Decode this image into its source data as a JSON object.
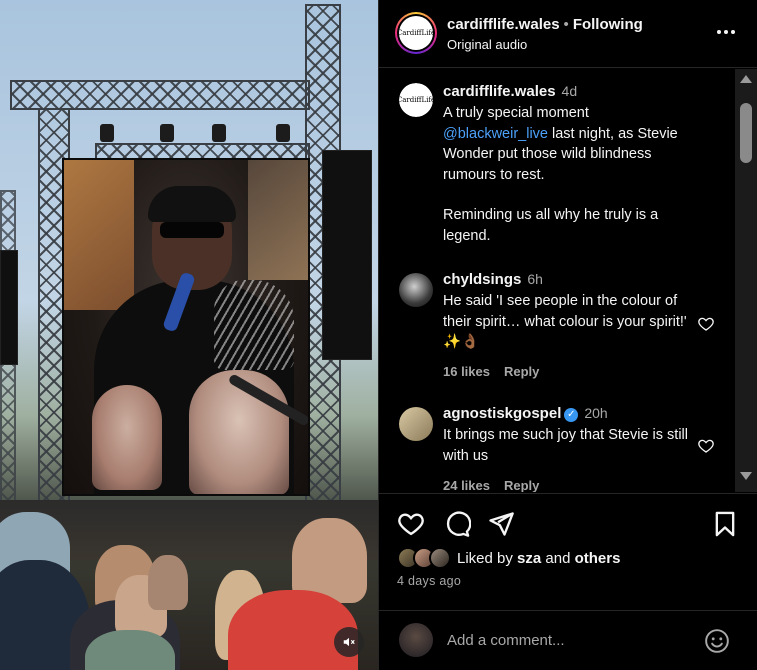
{
  "media": {
    "mute_icon": "speaker-muted-icon"
  },
  "header": {
    "username": "cardifflife.wales",
    "separator": "•",
    "follow_state": "Following",
    "audio": "Original audio",
    "avatar_text": "CardiffLife",
    "more_icon": "more-options-icon"
  },
  "caption": {
    "username": "cardifflife.wales",
    "time": "4d",
    "line1": "A truly special moment",
    "mention": "@blackweir_live",
    "line2": " last night, as Stevie Wonder put those wild blindness rumours to rest.",
    "line3": "Reminding us all why he truly is a legend."
  },
  "comments": [
    {
      "username": "chyldsings",
      "time": "6h",
      "text": "He said 'I see people in the colour of their spirit… what colour is your spirit!' ✨👌🏾",
      "likes": "16 likes",
      "reply": "Reply"
    },
    {
      "username": "agnostiskgospel",
      "verified": true,
      "time": "20h",
      "text": "It brings me such joy that Stevie is still with us",
      "likes": "24 likes",
      "reply": "Reply"
    }
  ],
  "actions": {
    "like_icon": "heart-icon",
    "comment_icon": "comment-icon",
    "share_icon": "share-icon",
    "save_icon": "bookmark-icon",
    "liked_by_prefix": "Liked by",
    "liked_by_user": "sza",
    "liked_by_and": "and",
    "liked_by_others": "others",
    "date": "4 days ago"
  },
  "composer": {
    "placeholder": "Add a comment...",
    "emoji_icon": "emoji-icon"
  },
  "colors": {
    "background": "#000000",
    "link": "#4ca0f8",
    "secondary_text": "#a8a8a8",
    "verified": "#3897f0"
  }
}
